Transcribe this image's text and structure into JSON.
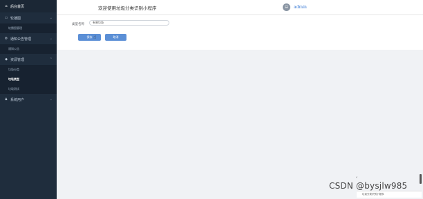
{
  "sidebar": {
    "home_label": "后台首页",
    "menu_info": "轮播图",
    "menu_info_sub": "轮播图管理",
    "menu_notice": "通知公告管理",
    "menu_notice_sub": "通知公告",
    "menu_resources": "资源管理",
    "resources_sub1": "垃圾分类",
    "resources_sub2": "垃圾类型",
    "resources_sub3": "垃圾测试",
    "menu_users": "系统用户"
  },
  "header": {
    "welcome": "欢迎使用垃圾分类识别小程序",
    "username": "admin"
  },
  "form": {
    "type_label": "类型名称",
    "type_value": "有害垃圾",
    "save_label": "保存",
    "cancel_label": "取消"
  },
  "overlay": {
    "watermark": "CSDN @bysjlw985",
    "tooltip_text": "垃圾分类识别小程序"
  }
}
